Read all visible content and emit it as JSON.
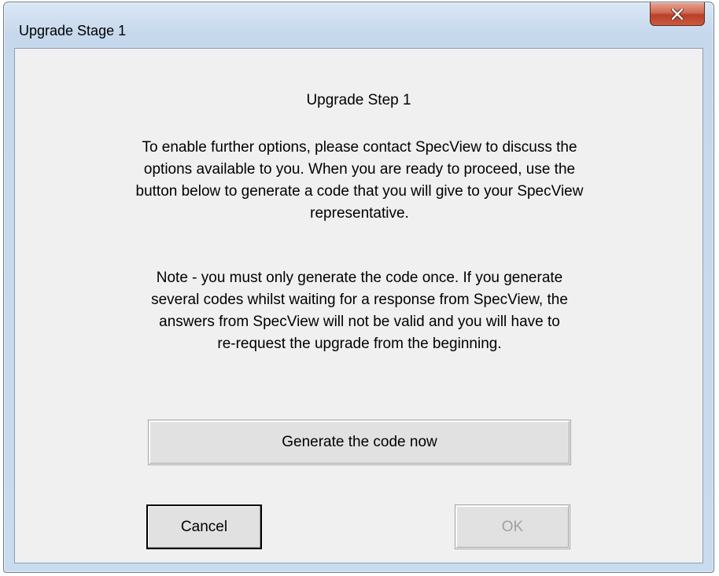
{
  "window": {
    "title": "Upgrade Stage 1",
    "close_icon": "close-icon"
  },
  "content": {
    "heading": "Upgrade Step 1",
    "paragraph1": [
      "To enable further options, please contact SpecView to discuss the",
      "options available to you.  When you are ready to proceed, use the",
      "button below to generate a code that you will give to your SpecView",
      "representative."
    ],
    "paragraph2": [
      "Note - you must only generate the code once.  If you generate",
      "several codes whilst waiting for a response from SpecView, the",
      "answers from SpecView will not be valid and you will have to",
      "re-request the upgrade from the beginning."
    ]
  },
  "buttons": {
    "generate_label": "Generate the code now",
    "cancel_label": "Cancel",
    "ok_label": "OK",
    "ok_enabled": false
  },
  "colors": {
    "close_button": "#c95a3f",
    "dialog_background": "#f0f0f0",
    "disabled_text": "#a0a0a0"
  }
}
